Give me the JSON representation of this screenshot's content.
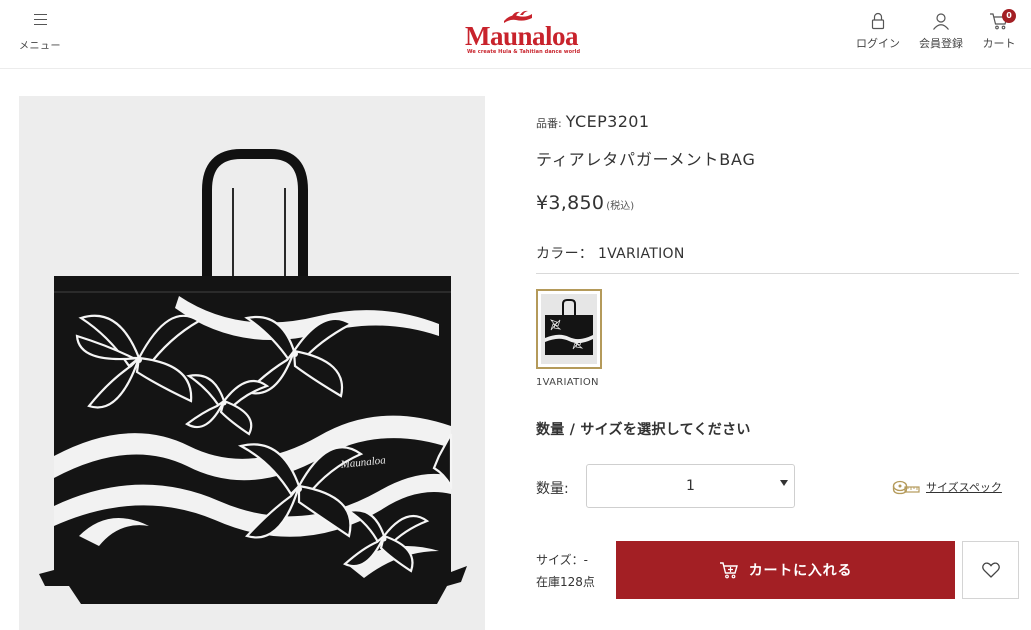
{
  "header": {
    "menu_label": "メニュー",
    "logo_text": "Maunaloa",
    "logo_tagline": "We create Hula & Tahitian dance world",
    "login_label": "ログイン",
    "register_label": "会員登録",
    "cart_label": "カート",
    "cart_count": "0"
  },
  "product": {
    "image_watermark": "Maunaloa",
    "sku_label": "品番:",
    "sku": "YCEP3201",
    "name": "ティアレタパガーメントBAG",
    "price": "¥3,850",
    "tax_note": "(税込)",
    "color_label": "カラー：",
    "color_value": "1VARIATION",
    "swatch_label": "1VARIATION",
    "select_heading": "数量 / サイズを選択してください",
    "qty_label": "数量:",
    "qty_value": "1",
    "size_spec_label": "サイズスペック",
    "size_line": "サイズ：-",
    "stock_line": "在庫128点",
    "add_to_cart_label": "カートに入れる"
  },
  "colors": {
    "accent": "#a31f24",
    "logo_red": "#c8232c",
    "swatch_border": "#b49a5a"
  }
}
